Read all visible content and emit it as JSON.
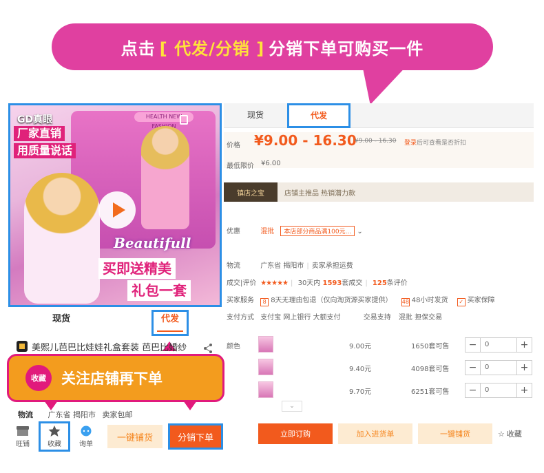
{
  "banner": {
    "prefix": "点击",
    "highlight": "[ 代发/分销 ]",
    "suffix": "分销下单可购买一件"
  },
  "mobile": {
    "media": {
      "brand": "GD真眼",
      "tag1": "厂家直销",
      "tag2": "用质量说话",
      "shelf_label": "HEALTH NEW FASHION",
      "logo": "Beautifull",
      "promo1": "买即送精美",
      "promo2": "礼包一套"
    },
    "tabs": [
      "现货",
      "代发"
    ],
    "title": "美熙儿芭巴比娃娃礼盒套装 芭巴比婚纱",
    "follow": {
      "badge": "收藏",
      "text": "关注店铺再下单"
    },
    "shipping": {
      "label": "物流",
      "region": "广东省 揭阳市",
      "note": "卖家包邮"
    },
    "bar": {
      "wangpu": "旺铺",
      "fav": "收藏",
      "ask": "询单",
      "ptx": "一键铺货",
      "dist": "分销下单"
    }
  },
  "desktop": {
    "tabs": [
      "现货",
      "代发"
    ],
    "price_label": "价格",
    "price": "¥9.00 - 16.30",
    "orig_price": "¥9.00 - 16.30",
    "login_link": "登录",
    "login_hint": "后可查看是否折扣",
    "min_label": "最低限价",
    "min_price": "¥6.00",
    "shop_badge": "镇店之宝",
    "shop_text": "店铺主推品  热销潜力款",
    "promo_label": "优惠",
    "promo_type": "混批",
    "promo_tag": "本店部分商品满100元...",
    "logistics_label": "物流",
    "logistics_region": "广东省 揭阳市",
    "logistics_note": "卖家承担运费",
    "rating_label": "成交|评价",
    "rating_stars": "★★★★★",
    "rating_30d": "30天内",
    "rating_deals": "1593",
    "rating_deals_suffix": "套成交",
    "rating_reviews": "125",
    "rating_reviews_suffix": "条评价",
    "service_label": "买家服务",
    "service1": "8天无理由包退（仅向淘货源买家提供）",
    "service2": "48小时发货",
    "service3": "买家保障",
    "pay_label": "支付方式",
    "pay_methods": "支付宝  网上银行  大额支付",
    "trade_label": "交易支持",
    "trade_methods": "混批  担保交易",
    "color_label": "颜色",
    "skus": [
      {
        "price": "9.00元",
        "stock": "1650套可售",
        "qty": "0"
      },
      {
        "price": "9.40元",
        "stock": "4098套可售",
        "qty": "0"
      },
      {
        "price": "9.70元",
        "stock": "6251套可售",
        "qty": "0"
      }
    ],
    "buttons": {
      "buy": "立即订购",
      "cart": "加入进货单",
      "ptx": "一键铺货",
      "fav": "收藏"
    }
  },
  "colors": {
    "accent": "#f25a1d",
    "banner": "#e040a0",
    "highlight_frame": "#2c8fe6",
    "follow_bg": "#f39c1e"
  }
}
